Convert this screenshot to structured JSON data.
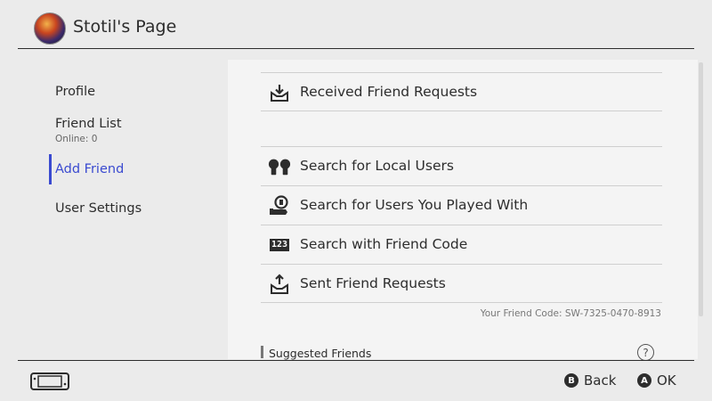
{
  "header": {
    "title": "Stotil's Page"
  },
  "sidebar": {
    "items": [
      {
        "label": "Profile"
      },
      {
        "label": "Friend List",
        "sub": "Online: 0"
      },
      {
        "label": "Add Friend"
      },
      {
        "label": "User Settings"
      }
    ],
    "active": "Add Friend"
  },
  "main": {
    "received": {
      "label": "Received Friend Requests",
      "icon": "inbox-download-icon"
    },
    "options": [
      {
        "label": "Search for Local Users",
        "icon": "local-users-icon"
      },
      {
        "label": "Search for Users You Played With",
        "icon": "played-with-icon"
      },
      {
        "label": "Search with Friend Code",
        "icon": "friend-code-icon",
        "icon_text": "123"
      },
      {
        "label": "Sent Friend Requests",
        "icon": "outbox-upload-icon"
      }
    ],
    "friend_code": "Your Friend Code: SW-7325-0470-8913",
    "suggested": "Suggested Friends",
    "help_glyph": "?"
  },
  "footer": {
    "back": {
      "button": "B",
      "label": "Back"
    },
    "ok": {
      "button": "A",
      "label": "OK"
    }
  },
  "colors": {
    "accent": "#3a4ad0",
    "text": "#2d2d2d",
    "panel": "#f4f4f4",
    "background": "#ebebeb"
  }
}
